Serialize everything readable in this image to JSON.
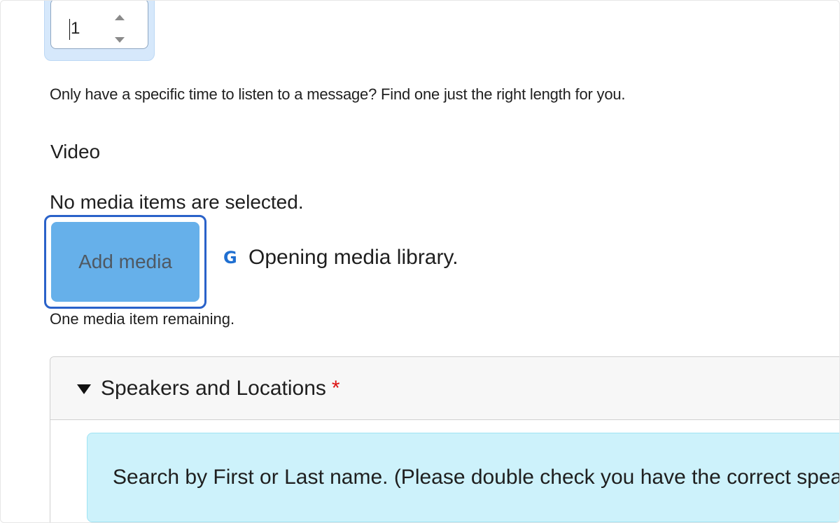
{
  "duration": {
    "value": "1"
  },
  "help_text": "Only have a specific time to listen to a message? Find one just the right length for you.",
  "video": {
    "label": "Video",
    "no_media_text": "No media items are selected.",
    "add_media_label": "Add media",
    "status_icon": "loading-g-icon",
    "status_text": "Opening media library.",
    "remaining_text": "One media item remaining."
  },
  "speakers": {
    "summary_label": "Speakers and Locations",
    "required_mark": "*",
    "info_text": "Search by First or Last name. (Please double check you have the correct spea"
  },
  "colors": {
    "button_bg": "#66b0ea",
    "focus_ring": "#2a62c9",
    "info_bg": "#cdf2fb",
    "required": "#dd1111"
  }
}
